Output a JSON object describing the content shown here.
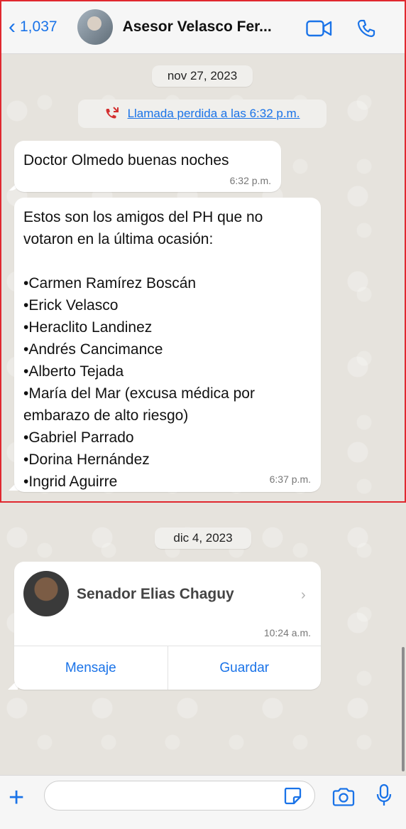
{
  "header": {
    "back_count": "1,037",
    "contact_name": "Asesor Velasco Fer...",
    "back_icon": "chevron-left-icon",
    "video_icon": "video-camera-icon",
    "call_icon": "phone-icon"
  },
  "chat": {
    "date1": "nov 27, 2023",
    "missed_call": "Llamada perdida a las 6:32 p.m.",
    "message1": {
      "text": "Doctor Olmedo buenas noches",
      "time": "6:32 p.m."
    },
    "message2": {
      "lines": [
        "Estos son los amigos del PH que no",
        "votaron en la última ocasión:",
        "",
        "•Carmen Ramírez Boscán",
        "•Erick Velasco",
        "•Heraclito Landinez",
        "•Andrés Cancimance",
        "•Alberto Tejada",
        "•María del Mar (excusa médica por",
        "embarazo de alto riesgo)",
        "•Gabriel Parrado",
        "•Dorina Hernández",
        "•Ingrid Aguirre"
      ],
      "time": "6:37 p.m."
    },
    "date2": "dic 4, 2023",
    "contact_card": {
      "name": "Senador Elias Chaguy",
      "time": "10:24 a.m.",
      "message_button": "Mensaje",
      "save_button": "Guardar"
    }
  },
  "input_bar": {
    "placeholder": "",
    "icons": [
      "plus-icon",
      "sticker-icon",
      "camera-icon",
      "microphone-icon"
    ]
  },
  "colors": {
    "accent": "#1a73e8",
    "missed_call": "#d32f2f",
    "annotation_frame": "#e0282f"
  }
}
